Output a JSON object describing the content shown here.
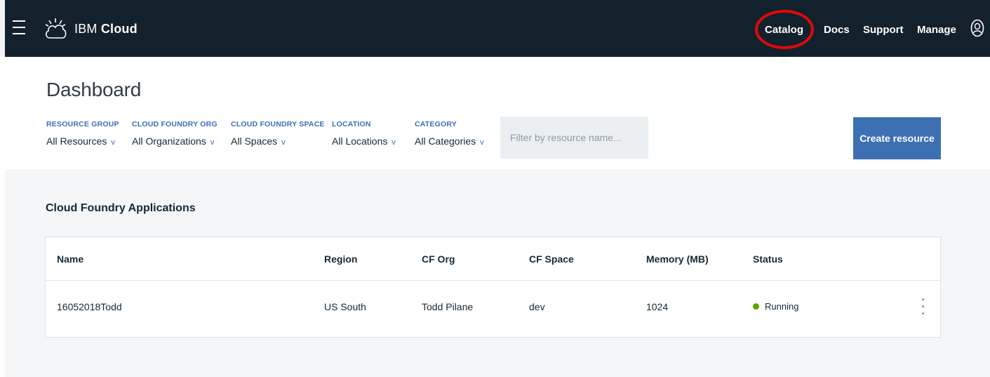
{
  "topbar": {
    "brand_prefix": "IBM",
    "brand_suffix": "Cloud",
    "nav": [
      "Catalog",
      "Docs",
      "Support",
      "Manage"
    ],
    "colors": {
      "background": "#13212d",
      "highlight_circle": "#e10909"
    }
  },
  "icons": {
    "menu": "hamburger-menu-icon",
    "logo": "ibm-cloud-logo-icon",
    "user": "user-avatar-icon",
    "dropdown": "chevron-down-icon",
    "status": "status-dot-icon",
    "more": "overflow-menu-icon"
  },
  "dashboard": {
    "title": "Dashboard",
    "filters": [
      {
        "label": "RESOURCE GROUP",
        "value": "All Resources"
      },
      {
        "label": "CLOUD FOUNDRY ORG",
        "value": "All Organizations"
      },
      {
        "label": "CLOUD FOUNDRY SPACE",
        "value": "All Spaces"
      },
      {
        "label": "LOCATION",
        "value": "All Locations"
      },
      {
        "label": "CATEGORY",
        "value": "All Categories"
      }
    ],
    "chevron": "v",
    "search": {
      "value": "",
      "placeholder": "Filter by resource name..."
    },
    "create_button": "Create resource",
    "accent_color": "#3d70b2"
  },
  "apps_section": {
    "title": "Cloud Foundry Applications",
    "columns": [
      "Name",
      "Region",
      "CF Org",
      "CF Space",
      "Memory (MB)",
      "Status"
    ],
    "rows": [
      {
        "name": "16052018Todd",
        "region": "US South",
        "cf_org": "Todd Pilane",
        "cf_space": "dev",
        "memory": "1024",
        "status": "Running",
        "status_color": "#5aa700"
      }
    ]
  }
}
